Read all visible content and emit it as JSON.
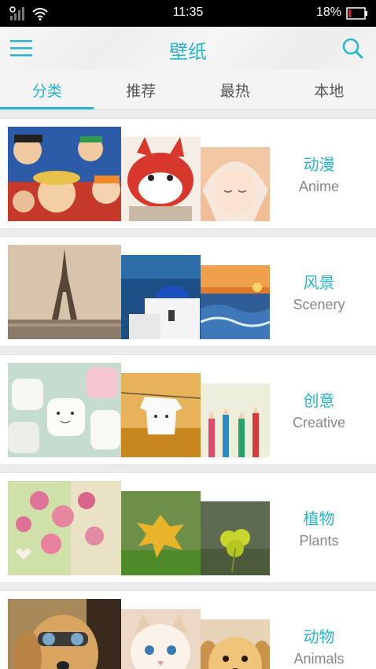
{
  "status_bar": {
    "time": "11:35",
    "battery_percent": "18%",
    "battery_color": "#e02020"
  },
  "app_bar": {
    "title": "壁纸",
    "accent_color": "#27b6cf",
    "left_icon": "menu-icon",
    "right_icon": "search-icon"
  },
  "tabs": [
    {
      "label": "分类",
      "active": true
    },
    {
      "label": "推荐",
      "active": false
    },
    {
      "label": "最热",
      "active": false
    },
    {
      "label": "本地",
      "active": false
    }
  ],
  "categories": [
    {
      "name_cn": "动漫",
      "name_en": "Anime",
      "images": [
        "one-piece-crew",
        "red-fox-cartoon",
        "anime-girl"
      ]
    },
    {
      "name_cn": "风景",
      "name_en": "Scenery",
      "images": [
        "eiffel-tower",
        "santorini-dome",
        "ocean-sunset"
      ]
    },
    {
      "name_cn": "创意",
      "name_en": "Creative",
      "images": [
        "marshmallow-faces",
        "shirt-clothesline",
        "colored-pencils"
      ]
    },
    {
      "name_cn": "植物",
      "name_en": "Plants",
      "images": [
        "pink-blossoms",
        "autumn-leaf",
        "clover"
      ]
    },
    {
      "name_cn": "动物",
      "name_en": "Animals",
      "images": [
        "dog-goggles",
        "kitten",
        "puppy"
      ]
    }
  ]
}
